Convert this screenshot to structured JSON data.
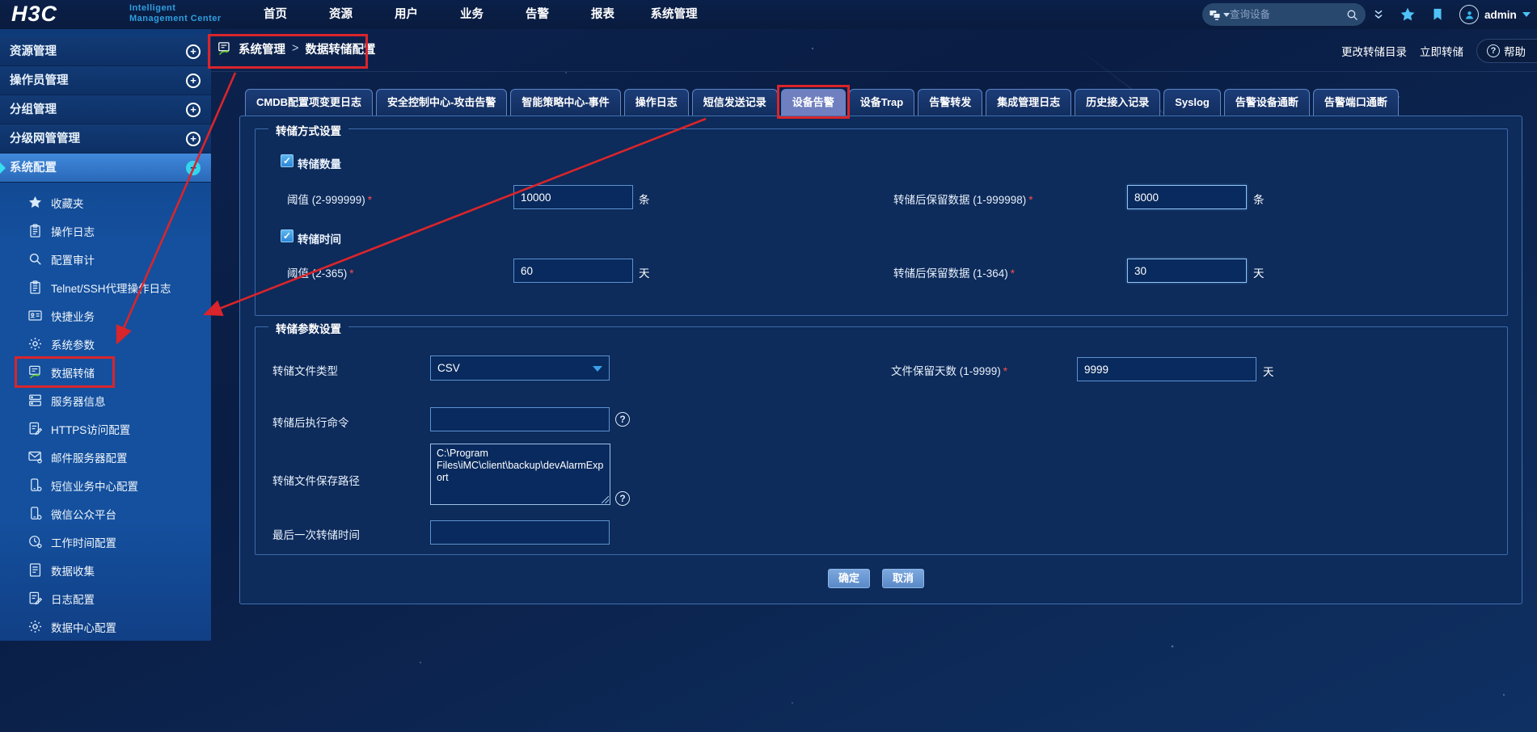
{
  "topbar": {
    "logo": "H3C",
    "tagline1": "Intelligent",
    "tagline2": "Management Center",
    "menu": [
      {
        "label": "首页"
      },
      {
        "label": "资源"
      },
      {
        "label": "用户"
      },
      {
        "label": "业务"
      },
      {
        "label": "告警"
      },
      {
        "label": "报表"
      },
      {
        "label": "系统管理"
      }
    ],
    "search": {
      "placeholder": "查询设备"
    },
    "user": {
      "name": "admin"
    }
  },
  "breadcrumb": {
    "parent": "系统管理",
    "separator": ">",
    "current": "数据转储配置"
  },
  "page_actions": {
    "change_dump_dir": "更改转储目录",
    "dump_now": "立即转储",
    "help": "帮助",
    "help_mark": "?"
  },
  "sidebar": {
    "groups": [
      {
        "label": "资源管理",
        "state": "collapsed"
      },
      {
        "label": "操作员管理",
        "state": "collapsed"
      },
      {
        "label": "分组管理",
        "state": "collapsed"
      },
      {
        "label": "分级网管管理",
        "state": "collapsed"
      },
      {
        "label": "系统配置",
        "state": "expanded"
      }
    ],
    "items": [
      {
        "label": "收藏夹",
        "icon": "star-icon"
      },
      {
        "label": "操作日志",
        "icon": "clipboard-icon"
      },
      {
        "label": "配置审计",
        "icon": "audit-search-icon"
      },
      {
        "label": "Telnet/SSH代理操作日志",
        "icon": "clipboard-icon"
      },
      {
        "label": "快捷业务",
        "icon": "id-card-icon"
      },
      {
        "label": "系统参数",
        "icon": "gear-icon"
      },
      {
        "label": "数据转储",
        "icon": "data-dump-icon",
        "annotated": true
      },
      {
        "label": "服务器信息",
        "icon": "server-icon"
      },
      {
        "label": "HTTPS访问配置",
        "icon": "document-edit-icon"
      },
      {
        "label": "邮件服务器配置",
        "icon": "mail-icon"
      },
      {
        "label": "短信业务中心配置",
        "icon": "phone-icon"
      },
      {
        "label": "微信公众平台",
        "icon": "phone-icon"
      },
      {
        "label": "工作时间配置",
        "icon": "clock-icon"
      },
      {
        "label": "数据收集",
        "icon": "document-icon"
      },
      {
        "label": "日志配置",
        "icon": "document-edit-icon"
      },
      {
        "label": "数据中心配置",
        "icon": "gear-icon"
      }
    ]
  },
  "tabs": [
    {
      "label": "CMDB配置项变更日志"
    },
    {
      "label": "安全控制中心-攻击告警"
    },
    {
      "label": "智能策略中心-事件"
    },
    {
      "label": "操作日志"
    },
    {
      "label": "短信发送记录"
    },
    {
      "label": "设备告警",
      "active": true,
      "annotated": true
    },
    {
      "label": "设备Trap"
    },
    {
      "label": "告警转发"
    },
    {
      "label": "集成管理日志"
    },
    {
      "label": "历史接入记录"
    },
    {
      "label": "Syslog"
    },
    {
      "label": "告警设备通断"
    },
    {
      "label": "告警端口通断"
    }
  ],
  "form": {
    "required_mark": "*",
    "section1": {
      "title": "转储方式设置",
      "quantity_checkbox": "转储数量",
      "time_checkbox": "转储时间",
      "threshold_qty_label": "阈值 (2-999999)",
      "threshold_qty_value": "10000",
      "threshold_qty_unit": "条",
      "keep_qty_label": "转储后保留数据 (1-999998)",
      "keep_qty_value": "8000",
      "keep_qty_unit": "条",
      "threshold_time_label": "阈值 (2-365)",
      "threshold_time_value": "60",
      "threshold_time_unit": "天",
      "keep_time_label": "转储后保留数据 (1-364)",
      "keep_time_value": "30",
      "keep_time_unit": "天"
    },
    "section2": {
      "title": "转储参数设置",
      "file_type_label": "转储文件类型",
      "file_type_value": "CSV",
      "keep_days_label": "文件保留天数 (1-9999)",
      "keep_days_value": "9999",
      "keep_days_unit": "天",
      "command_label": "转储后执行命令",
      "command_value": "",
      "path_label": "转储文件保存路径",
      "path_value": "C:\\Program Files\\iMC\\client\\backup\\devAlarmExport",
      "last_dump_label": "最后一次转储时间",
      "last_dump_value": ""
    },
    "buttons": {
      "ok": "确定",
      "cancel": "取消"
    }
  }
}
